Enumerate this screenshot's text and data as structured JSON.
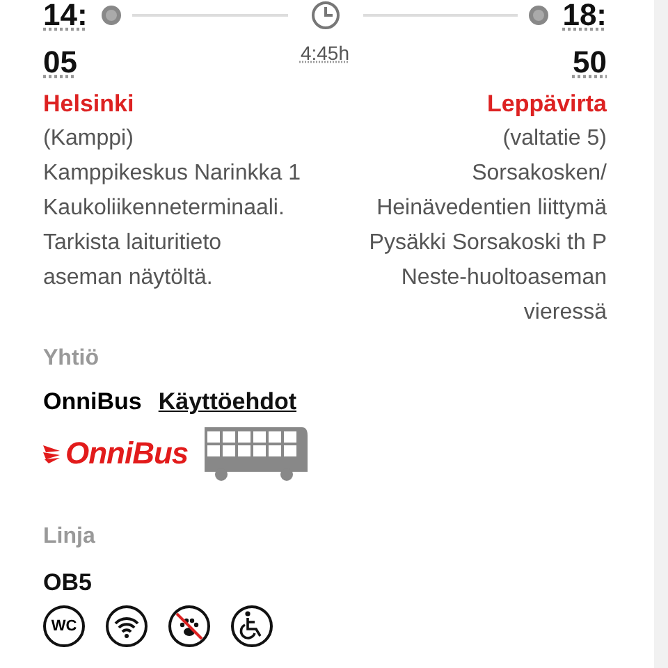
{
  "departure": {
    "time": "14:05",
    "city": "Helsinki",
    "details": [
      "(Kamppi)",
      "Kamppikeskus Narinkka 1 Kaukoliikenneterminaali. Tarkista laituritieto aseman näytöltä."
    ]
  },
  "duration": "4:45h",
  "arrival": {
    "time": "18:50",
    "city": "Leppävirta",
    "details": [
      "(valtatie 5)",
      "Sorsakosken/ Heinävedentien liittymä Pysäkki Sorsakoski th P Neste-huoltoaseman vieressä"
    ]
  },
  "company": {
    "heading": "Yhtiö",
    "name": "OnniBus",
    "terms_link": "Käyttöehdot",
    "logo_text": "OnniBus"
  },
  "line": {
    "heading": "Linja",
    "code": "OB5"
  },
  "amenities": [
    {
      "kind": "wc",
      "label": "WC"
    },
    {
      "kind": "wifi"
    },
    {
      "kind": "no-pets"
    },
    {
      "kind": "wheelchair"
    }
  ]
}
